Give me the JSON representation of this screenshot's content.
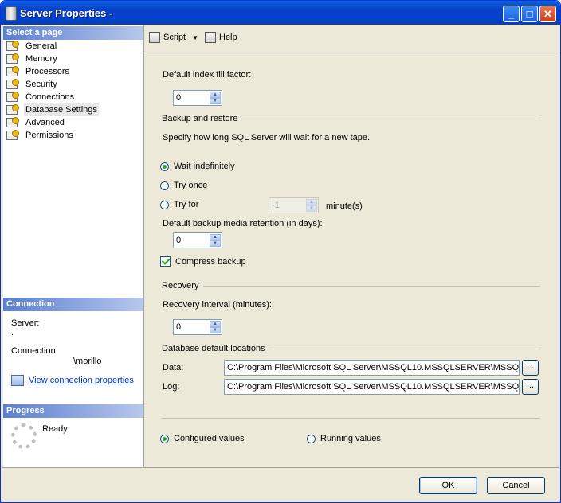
{
  "window": {
    "title": "Server Properties -"
  },
  "sidebar": {
    "select_header": "Select a page",
    "pages": [
      {
        "label": "General"
      },
      {
        "label": "Memory"
      },
      {
        "label": "Processors"
      },
      {
        "label": "Security"
      },
      {
        "label": "Connections"
      },
      {
        "label": "Database Settings"
      },
      {
        "label": "Advanced"
      },
      {
        "label": "Permissions"
      }
    ],
    "selected_page": "Database Settings",
    "connection_header": "Connection",
    "server_label": "Server:",
    "server_value": ".",
    "connection_label": "Connection:",
    "connection_value": "\\morillo",
    "view_connection_link": "View connection properties",
    "progress_header": "Progress",
    "progress_status": "Ready"
  },
  "toolbar": {
    "script_label": "Script",
    "help_label": "Help"
  },
  "form": {
    "fill_factor_label": "Default index fill factor:",
    "fill_factor_value": "0",
    "backup_section": "Backup and restore",
    "backup_description": "Specify how long SQL Server will wait for a new tape.",
    "wait_indefinitely": "Wait indefinitely",
    "try_once": "Try once",
    "try_for": "Try for",
    "try_for_value": "-1",
    "minutes_label": "minute(s)",
    "retention_label": "Default backup media retention (in days):",
    "retention_value": "0",
    "compress_backup": "Compress backup",
    "recovery_section": "Recovery",
    "recovery_interval_label": "Recovery interval (minutes):",
    "recovery_interval_value": "0",
    "locations_section": "Database default locations",
    "data_label": "Data:",
    "data_path": "C:\\Program Files\\Microsoft SQL Server\\MSSQL10.MSSQLSERVER\\MSSQL",
    "log_label": "Log:",
    "log_path": "C:\\Program Files\\Microsoft SQL Server\\MSSQL10.MSSQLSERVER\\MSSQL",
    "browse_label": "...",
    "configured_values": "Configured values",
    "running_values": "Running values"
  },
  "buttons": {
    "ok": "OK",
    "cancel": "Cancel"
  }
}
